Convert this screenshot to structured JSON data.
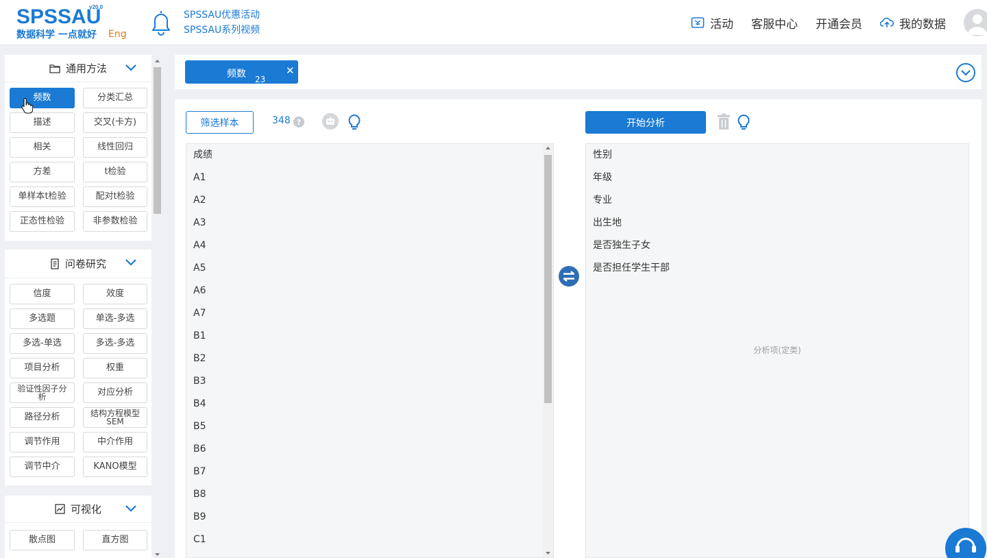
{
  "header": {
    "logo_text": "SPSSAU",
    "logo_version": "v20.0",
    "logo_tagline": "数据科学 一点就好",
    "lang_switch": "Eng",
    "promo_lines": [
      "SPSSAU优惠活动",
      "SPSSAU系列视频"
    ],
    "nav": {
      "activity": "活动",
      "support": "客服中心",
      "membership": "开通会员",
      "my_data": "我的数据"
    }
  },
  "sidebar": {
    "sections": [
      {
        "title": "通用方法",
        "items": [
          "频数",
          "分类汇总",
          "描述",
          "交叉(卡方)",
          "相关",
          "线性回归",
          "方差",
          "t检验",
          "单样本t检验",
          "配对t检验",
          "正态性检验",
          "非参数检验"
        ],
        "active": "频数"
      },
      {
        "title": "问卷研究",
        "items": [
          "信度",
          "效度",
          "多选题",
          "单选-多选",
          "多选-单选",
          "多选-多选",
          "项目分析",
          "权重",
          "验证性因子分析",
          "对应分析",
          "路径分析",
          "结构方程模型SEM",
          "调节作用",
          "中介作用",
          "调节中介",
          "KANO模型"
        ]
      },
      {
        "title": "可视化",
        "items": [
          "散点图",
          "直方图"
        ]
      }
    ]
  },
  "tabbar": {
    "tabs": [
      {
        "label": "频数",
        "count": "23"
      }
    ]
  },
  "workspace": {
    "filter_button": "筛选样本",
    "sample_count": "348",
    "help": "?",
    "start_button": "开始分析",
    "variables": [
      "成绩",
      "A1",
      "A2",
      "A3",
      "A4",
      "A5",
      "A6",
      "A7",
      "B1",
      "B2",
      "B3",
      "B4",
      "B5",
      "B6",
      "B7",
      "B8",
      "B9",
      "C1"
    ],
    "selected": [
      "性别",
      "年级",
      "专业",
      "出生地",
      "是否独生子女",
      "是否担任学生干部"
    ],
    "drop_placeholder": "分析项(定类)"
  },
  "colors": {
    "accent": "#1a7ad4",
    "orange": "#e07b22",
    "panel_bg": "#f5f6f7",
    "page_bg": "#eef0f3"
  }
}
